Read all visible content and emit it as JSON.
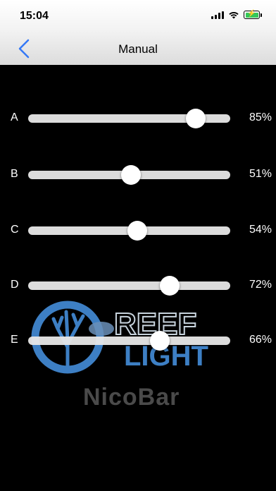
{
  "status": {
    "time": "15:04",
    "battery_color": "#35c759"
  },
  "nav": {
    "back_icon": "chevron-left-icon",
    "title": "Manual",
    "accent": "#3478f6"
  },
  "logo": {
    "wordmark_top": "REEF",
    "wordmark_bottom": "LIGHT",
    "product": "NicoBar"
  },
  "channels": [
    {
      "label": "A",
      "value_text": "85%",
      "level": 0.83
    },
    {
      "label": "B",
      "value_text": "51%",
      "level": 0.51
    },
    {
      "label": "C",
      "value_text": "54%",
      "level": 0.54
    },
    {
      "label": "D",
      "value_text": "72%",
      "level": 0.7
    },
    {
      "label": "E",
      "value_text": "66%",
      "level": 0.65
    }
  ]
}
